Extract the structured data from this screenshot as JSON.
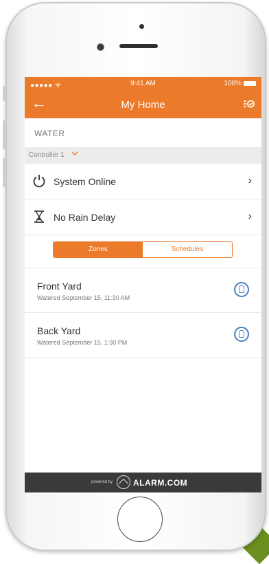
{
  "status_bar": {
    "signal": "●●●●● ᯤ",
    "time": "9:41 AM",
    "battery": "100%"
  },
  "nav": {
    "back_icon": "arrow-left-icon",
    "title": "My Home",
    "menu_icon": "list-check-icon"
  },
  "section": {
    "label": "WATER"
  },
  "controller": {
    "label": "Controller 1"
  },
  "rows": [
    {
      "label": "System Online",
      "icon": "power-icon"
    },
    {
      "label": "No Rain Delay",
      "icon": "hourglass-icon"
    }
  ],
  "tabs": [
    {
      "label": "Zones",
      "active": true
    },
    {
      "label": "Schedules",
      "active": false
    }
  ],
  "zones": [
    {
      "name": "Front Yard",
      "subtitle": "Watered September 15, 11:30 AM",
      "icon": "sprinkler-icon"
    },
    {
      "name": "Back Yard",
      "subtitle": "Watered September 15, 1:30 PM",
      "icon": "sprinkler-icon"
    }
  ],
  "footer": {
    "powered_by": "powered by",
    "brand": "ALARM.COM"
  },
  "colors": {
    "accent": "#ec7a2b",
    "zone_icon": "#4a7fc0",
    "footer": "#3a3a3a"
  }
}
